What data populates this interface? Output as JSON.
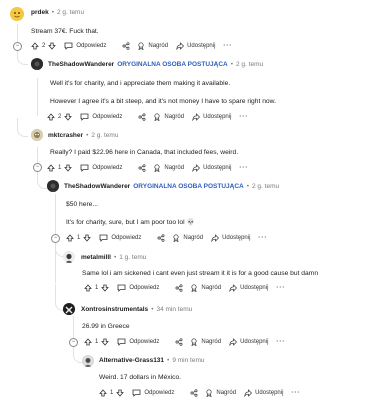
{
  "comments": [
    {
      "author": "prdek",
      "time": "2 g. temu",
      "op_label": "",
      "lines": [
        "Stream 37€. Fuck that."
      ],
      "votes": "2",
      "reply": "Odpowiedz",
      "award": "Nagród",
      "share": "Udostępnij"
    },
    {
      "author": "TheShadowWanderer",
      "op_label": "ORYGINALNA OSOBA POSTUJĄCA",
      "time": "2 g. temu",
      "lines": [
        "Well it's for charity, and i appreciate them making it available.",
        "However I agree it's a bit steep, and it's not money I have to spare right now."
      ],
      "votes": "2",
      "reply": "Odpowiedz",
      "award": "Nagród",
      "share": "Udostępnij"
    },
    {
      "author": "mktcrasher",
      "op_label": "",
      "time": "2 g. temu",
      "lines": [
        "Really? I paid $22.96 here in Canada, that included fees, weird."
      ],
      "votes": "1",
      "reply": "Odpowiedz",
      "award": "Nagród",
      "share": "Udostępnij"
    },
    {
      "author": "TheShadowWanderer",
      "op_label": "ORYGINALNA OSOBA POSTUJĄCA",
      "time": "2 g. temu",
      "lines": [
        "$50 here...",
        "It's for charity, sure, but I am poor too lol 💀"
      ],
      "votes": "1",
      "reply": "Odpowiedz",
      "award": "Nagród",
      "share": "Udostępnij"
    },
    {
      "author": "metalmilll",
      "op_label": "",
      "time": "1 g. temu",
      "lines": [
        "Same lol i am sickened i cant even just stream it it is for a good cause but damn"
      ],
      "votes": "1",
      "reply": "Odpowiedz",
      "award": "Nagród",
      "share": "Udostępnij"
    },
    {
      "author": "Xontrosinstrumentals",
      "op_label": "",
      "time": "34 min temu",
      "lines": [
        "26.99 in Greece"
      ],
      "votes": "1",
      "reply": "Odpowiedz",
      "award": "Nagród",
      "share": "Udostępnij"
    },
    {
      "author": "Alternative-Grass131",
      "op_label": "",
      "time": "9 min temu",
      "lines": [
        "Weird. 17 dollars in México."
      ],
      "votes": "1",
      "reply": "Odpowiedz",
      "award": "Nagród",
      "share": "Udostępnij"
    }
  ],
  "separator": "•",
  "collapse_symbol": "−",
  "colors": {
    "op_label": "#2f5ebd",
    "thread_line": "#dfe3e6",
    "meta": "#787c7e"
  }
}
